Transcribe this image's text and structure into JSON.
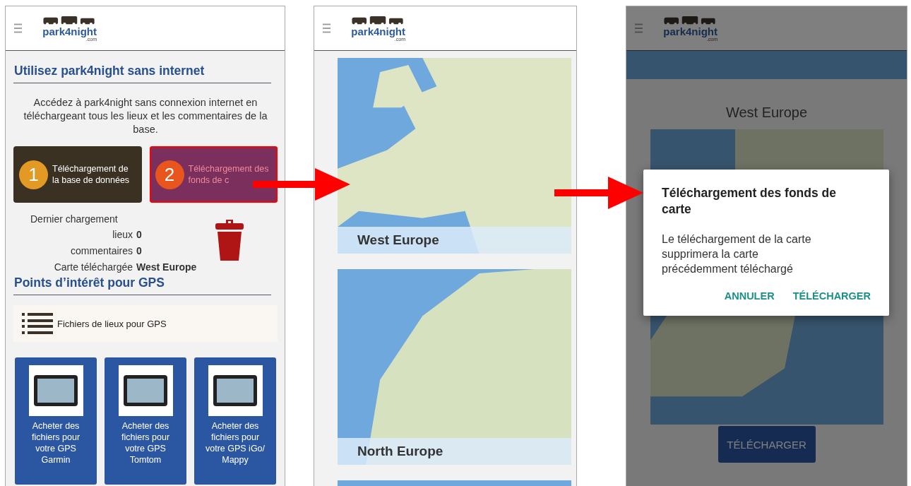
{
  "offline_screen": {
    "logo": {
      "name": "park4night",
      "suffix": ".com"
    },
    "title": "Utilisez park4night sans internet",
    "intro": "Accédez à park4night sans connexion internet en téléchargeant tous les lieux et les commentaires de la base.",
    "steps": [
      {
        "number": "1",
        "label": "Téléchargement de la base de données",
        "selected": false
      },
      {
        "number": "2",
        "label": "Téléchargement des fonds de c",
        "selected": true
      }
    ],
    "last_download": "Dernier chargement",
    "stats": [
      {
        "label": "lieux",
        "value": "0"
      },
      {
        "label": "commentaires",
        "value": "0"
      },
      {
        "label": "Carte téléchargée",
        "value": "West Europe"
      }
    ],
    "gps_title": "Points d’intérêt pour GPS",
    "gps_files": "Fichiers de lieux pour GPS",
    "gps_cards": [
      {
        "label": "Acheter des fichiers pour votre GPS Garmin"
      },
      {
        "label": "Acheter des fichiers pour votre GPS Tomtom"
      },
      {
        "label": "Acheter des fichiers pour votre GPS iGo/ Mappy"
      }
    ]
  },
  "maps_screen": {
    "logo": {
      "name": "park4night",
      "suffix": ".com"
    },
    "maps": [
      {
        "name": "West Europe"
      },
      {
        "name": "North Europe"
      }
    ]
  },
  "dialog_screen": {
    "logo": {
      "name": "park4night",
      "suffix": ".com"
    },
    "map_title": "West Europe",
    "download_button": "TÉLÉCHARGER",
    "dialog": {
      "title": "Téléchargement des fonds de carte",
      "message": "Le téléchargement de la carte supprimera la carte précédemment téléchargé",
      "buttons": [
        "ANNULER",
        "TÉLÉCHARGER"
      ]
    }
  }
}
